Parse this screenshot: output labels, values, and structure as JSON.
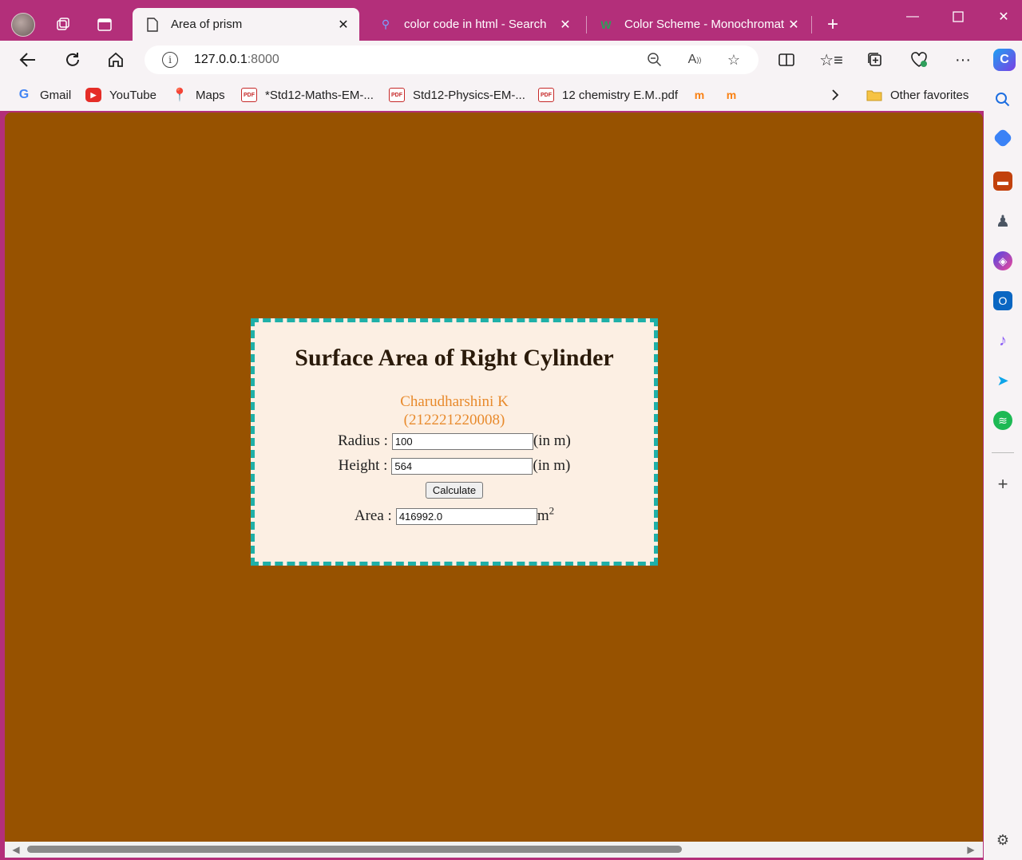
{
  "browser": {
    "tabs": [
      {
        "label": "Area of prism",
        "active": true
      },
      {
        "label": "color code in html - Search",
        "active": false
      },
      {
        "label": "Color Scheme - Monochromat",
        "active": false
      }
    ],
    "address": {
      "host": "127.0.0.1",
      "port": ":8000"
    },
    "favorites": [
      {
        "label": "Gmail",
        "icon": "gmail-icon"
      },
      {
        "label": "YouTube",
        "icon": "youtube-icon"
      },
      {
        "label": "Maps",
        "icon": "maps-icon"
      },
      {
        "label": "*Std12-Maths-EM-...",
        "icon": "pdf-icon"
      },
      {
        "label": "Std12-Physics-EM-...",
        "icon": "pdf-icon"
      },
      {
        "label": "12 chemistry E.M..pdf",
        "icon": "pdf-icon"
      }
    ],
    "other_favorites": "Other favorites",
    "colors": {
      "frame": "#b32f7a",
      "page_bg": "#975200",
      "card_bg": "#fcefe3",
      "card_border": "#1fb0a8",
      "author": "#e88a2c"
    }
  },
  "page": {
    "title": "Surface Area of Right Cylinder",
    "author_name": "Charudharshini K",
    "author_id": "(212221220008)",
    "radius_label": "Radius :",
    "radius_value": "100",
    "height_label": "Height :",
    "height_value": "564",
    "unit": "(in m)",
    "calculate_label": "Calculate",
    "area_label": "Area :",
    "area_value": "416992.0",
    "area_unit": "m",
    "area_unit_exp": "2"
  }
}
